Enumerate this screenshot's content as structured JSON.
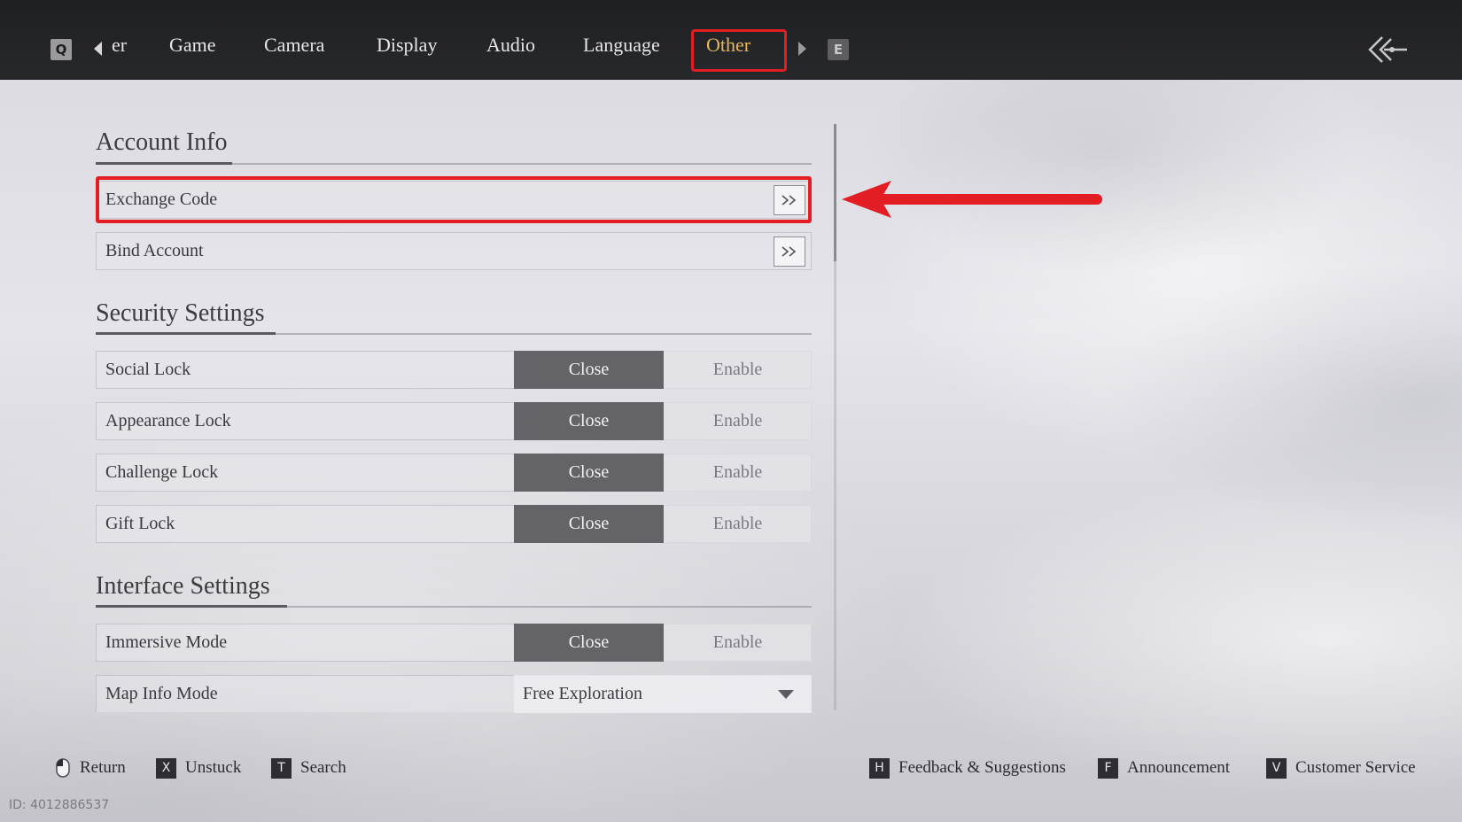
{
  "topbar": {
    "left_key": "Q",
    "right_key": "E",
    "tabs": [
      {
        "label": "er",
        "active": false
      },
      {
        "label": "Game",
        "active": false
      },
      {
        "label": "Camera",
        "active": false
      },
      {
        "label": "Display",
        "active": false
      },
      {
        "label": "Audio",
        "active": false
      },
      {
        "label": "Language",
        "active": false
      },
      {
        "label": "Other",
        "active": true
      }
    ]
  },
  "sections": {
    "account": {
      "title": "Account Info",
      "items": [
        {
          "label": "Exchange Code",
          "action_icon": "double-chevron-right-icon"
        },
        {
          "label": "Bind Account",
          "action_icon": "double-chevron-right-icon"
        }
      ]
    },
    "security": {
      "title": "Security Settings",
      "items": [
        {
          "label": "Social Lock",
          "selected": "Close",
          "off": "Close",
          "on": "Enable"
        },
        {
          "label": "Appearance Lock",
          "selected": "Close",
          "off": "Close",
          "on": "Enable"
        },
        {
          "label": "Challenge Lock",
          "selected": "Close",
          "off": "Close",
          "on": "Enable"
        },
        {
          "label": "Gift Lock",
          "selected": "Close",
          "off": "Close",
          "on": "Enable"
        }
      ]
    },
    "interface": {
      "title": "Interface Settings",
      "items": [
        {
          "label": "Immersive Mode",
          "selected": "Close",
          "off": "Close",
          "on": "Enable"
        },
        {
          "label": "Map Info Mode",
          "value": "Free Exploration"
        }
      ]
    }
  },
  "bottombar": {
    "left": [
      {
        "key": "mouse-icon",
        "label": "Return"
      },
      {
        "key": "X",
        "label": "Unstuck"
      },
      {
        "key": "T",
        "label": "Search"
      }
    ],
    "right": [
      {
        "key": "H",
        "label": "Feedback & Suggestions"
      },
      {
        "key": "F",
        "label": "Announcement"
      },
      {
        "key": "V",
        "label": "Customer Service"
      }
    ]
  },
  "id_text": "ID: 4012886537",
  "colors": {
    "active_tab": "#e6b75c",
    "annotation_red": "#e21d24",
    "selected_segment": "#646468"
  }
}
